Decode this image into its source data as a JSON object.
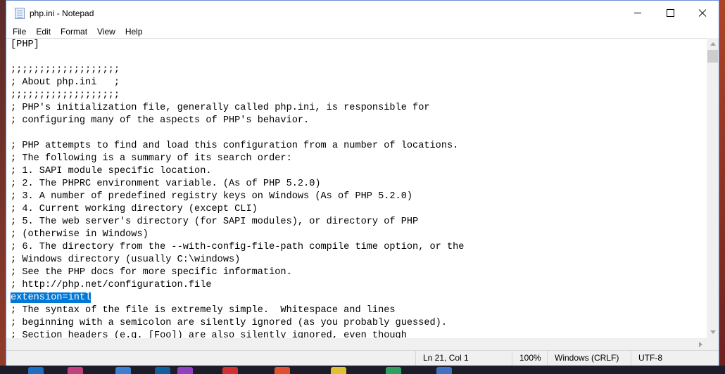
{
  "window": {
    "title": "php.ini - Notepad"
  },
  "menu": [
    "File",
    "Edit",
    "Format",
    "View",
    "Help"
  ],
  "editor": {
    "lines": [
      "[PHP]",
      "",
      ";;;;;;;;;;;;;;;;;;;",
      "; About php.ini   ;",
      ";;;;;;;;;;;;;;;;;;;",
      "; PHP's initialization file, generally called php.ini, is responsible for",
      "; configuring many of the aspects of PHP's behavior.",
      "",
      "; PHP attempts to find and load this configuration from a number of locations.",
      "; The following is a summary of its search order:",
      "; 1. SAPI module specific location.",
      "; 2. The PHPRC environment variable. (As of PHP 5.2.0)",
      "; 3. A number of predefined registry keys on Windows (As of PHP 5.2.0)",
      "; 4. Current working directory (except CLI)",
      "; 5. The web server's directory (for SAPI modules), or directory of PHP",
      "; (otherwise in Windows)",
      "; 6. The directory from the --with-config-file-path compile time option, or the",
      "; Windows directory (usually C:\\windows)",
      "; See the PHP docs for more specific information.",
      "; http://php.net/configuration.file",
      "extension=intl",
      "; The syntax of the file is extremely simple.  Whitespace and lines",
      "; beginning with a semicolon are silently ignored (as you probably guessed).",
      "; Section headers (e.g. [Foo]) are also silently ignored, even though"
    ],
    "selected_line": 20
  },
  "status": {
    "position": "Ln 21, Col 1",
    "zoom": "100%",
    "line_ending": "Windows (CRLF)",
    "encoding": "UTF-8"
  },
  "taskbar": {
    "icon_colors": [
      "#1e6fc0",
      "#c04080",
      "#3a7fd0",
      "#1060a0",
      "#d03030",
      "#9040c0",
      "#e05030",
      "#e0c030",
      "#30a060",
      "#4070c0"
    ]
  }
}
